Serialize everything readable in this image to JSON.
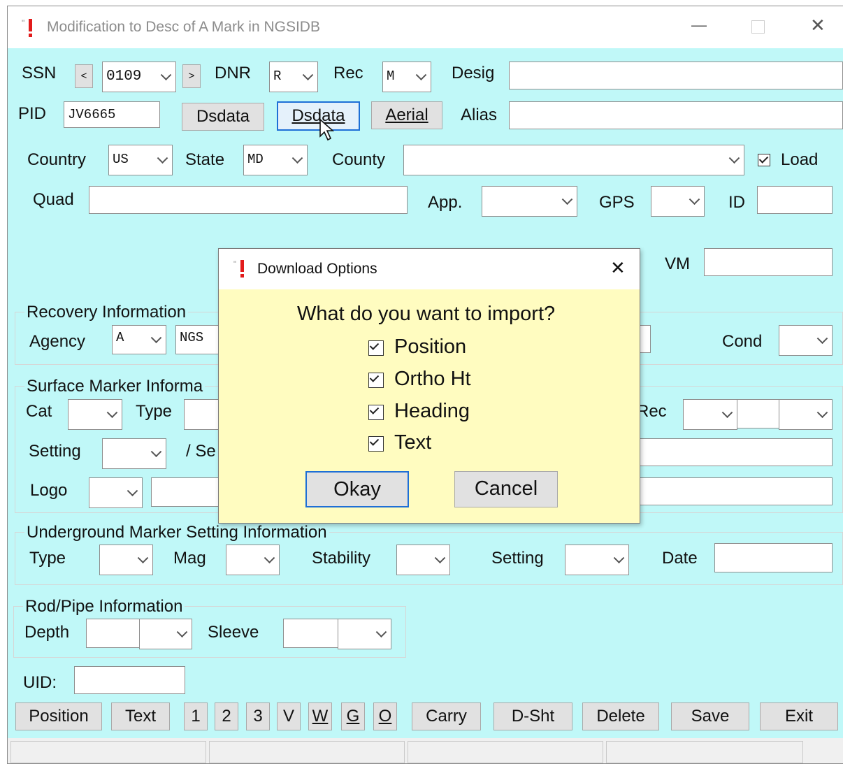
{
  "window": {
    "title": "Modification to Desc of A Mark in NGSIDB",
    "controls": {
      "minimize": "—",
      "close": "✕"
    }
  },
  "identity": {
    "ssn_label": "SSN",
    "ssn_prev": "<",
    "ssn_value": "0109",
    "ssn_next": ">",
    "dnr_label": "DNR",
    "dnr_value": "R",
    "rec_label": "Rec",
    "rec_value": "M",
    "desig_label": "Desig",
    "pid_label": "PID",
    "pid_value": "JV6665",
    "dsdata1": "Dsdata",
    "dsdata2": "Dsdata",
    "aerial": "Aerial",
    "alias_label": "Alias"
  },
  "location": {
    "country_label": "Country",
    "country_value": "US",
    "state_label": "State",
    "state_value": "MD",
    "county_label": "County",
    "load_label": "Load",
    "quad_label": "Quad",
    "app_label": "App.",
    "gps_label": "GPS",
    "id_label": "ID",
    "vm_label": "VM"
  },
  "recovery": {
    "title": "Recovery Information",
    "agency_label": "Agency",
    "agency_value": "A",
    "agency_code": "NGS",
    "cond_label": "Cond"
  },
  "surface": {
    "title": "Surface Marker Informa",
    "cat_label": "Cat",
    "type_label": "Type",
    "rec_label": "Rec",
    "setting_label": "Setting",
    "se_label": "/ Se",
    "logo_label": "Logo"
  },
  "underground": {
    "title": "Underground Marker Setting Information",
    "type_label": "Type",
    "mag_label": "Mag",
    "stability_label": "Stability",
    "setting_label": "Setting",
    "date_label": "Date"
  },
  "rod": {
    "title": "Rod/Pipe Information",
    "depth_label": "Depth",
    "sleeve_label": "Sleeve"
  },
  "uid_label": "UID:",
  "buttons": {
    "position": "Position",
    "text": "Text",
    "b1": "1",
    "b2": "2",
    "b3": "3",
    "v": "V",
    "w": "W",
    "g": "G",
    "o": "O",
    "carry": "Carry",
    "dsht": "D-Sht",
    "delete": "Delete",
    "save": "Save",
    "exit": "Exit"
  },
  "dialog": {
    "title": "Download Options",
    "close": "✕",
    "question": "What do you want to import?",
    "options": [
      "Position",
      "Ortho Ht",
      "Heading",
      "Text"
    ],
    "okay": "Okay",
    "cancel": "Cancel"
  }
}
